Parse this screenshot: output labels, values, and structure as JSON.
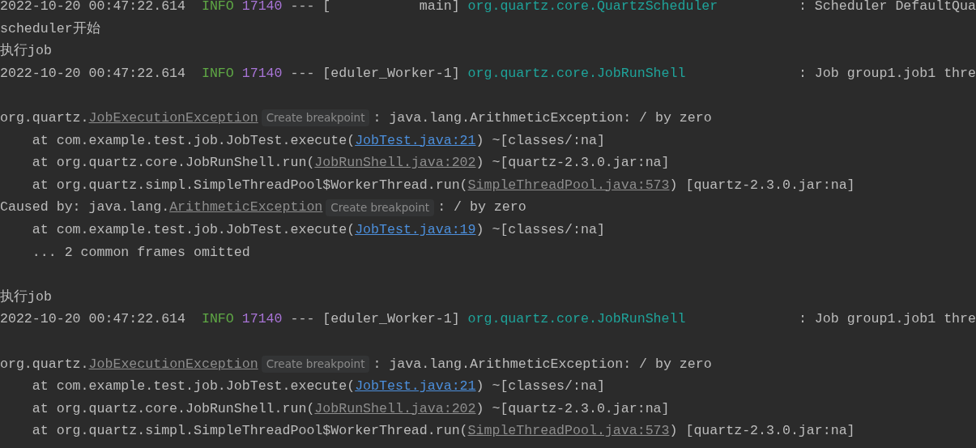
{
  "console": {
    "lines": [
      {
        "kind": "log",
        "timestamp": "2022-10-20 00:47:22.614",
        "level": "INFO",
        "pid": "17140",
        "separator": "---",
        "thread": "[           main]",
        "logger": "org.quartz.core.QuartzScheduler",
        "message": ": Scheduler DefaultQua"
      },
      {
        "kind": "text",
        "parts": [
          {
            "kind": "plain",
            "text": "scheduler开始"
          }
        ]
      },
      {
        "kind": "text",
        "parts": [
          {
            "kind": "plain",
            "text": "执行job"
          }
        ]
      },
      {
        "kind": "log",
        "timestamp": "2022-10-20 00:47:22.614",
        "level": "INFO",
        "pid": "17140",
        "separator": "---",
        "thread": "[eduler_Worker-1]",
        "logger": "org.quartz.core.JobRunShell",
        "message": ": Job group1.job1 thre"
      },
      {
        "kind": "blank"
      },
      {
        "kind": "text",
        "parts": [
          {
            "kind": "plain",
            "text": "org.quartz."
          },
          {
            "kind": "class_link",
            "text": "JobExecutionException"
          },
          {
            "kind": "hint",
            "text": "Create breakpoint"
          },
          {
            "kind": "plain",
            "text": ": java.lang.ArithmeticException: / by zero"
          }
        ]
      },
      {
        "kind": "frame",
        "parts": [
          {
            "kind": "plain",
            "text": "at com.example.test.job.JobTest.execute("
          },
          {
            "kind": "link",
            "text": "JobTest.java:21"
          },
          {
            "kind": "plain",
            "text": ") ~[classes/:na]"
          }
        ]
      },
      {
        "kind": "frame",
        "parts": [
          {
            "kind": "plain",
            "text": "at org.quartz.core.JobRunShell.run("
          },
          {
            "kind": "file_link",
            "text": "JobRunShell.java:202"
          },
          {
            "kind": "plain",
            "text": ") ~[quartz-2.3.0.jar:na]"
          }
        ]
      },
      {
        "kind": "frame",
        "parts": [
          {
            "kind": "plain",
            "text": "at org.quartz.simpl.SimpleThreadPool$WorkerThread.run("
          },
          {
            "kind": "file_link",
            "text": "SimpleThreadPool.java:573"
          },
          {
            "kind": "plain",
            "text": ") [quartz-2.3.0.jar:na]"
          }
        ]
      },
      {
        "kind": "text",
        "parts": [
          {
            "kind": "plain",
            "text": "Caused by: java.lang."
          },
          {
            "kind": "class_link",
            "text": "ArithmeticException"
          },
          {
            "kind": "hint",
            "text": "Create breakpoint"
          },
          {
            "kind": "plain",
            "text": ": / by zero"
          }
        ]
      },
      {
        "kind": "frame",
        "parts": [
          {
            "kind": "plain",
            "text": "at com.example.test.job.JobTest.execute("
          },
          {
            "kind": "link",
            "text": "JobTest.java:19"
          },
          {
            "kind": "plain",
            "text": ") ~[classes/:na]"
          }
        ]
      },
      {
        "kind": "frame",
        "parts": [
          {
            "kind": "plain",
            "text": "... 2 common frames omitted"
          }
        ]
      },
      {
        "kind": "blank"
      },
      {
        "kind": "text",
        "parts": [
          {
            "kind": "plain",
            "text": "执行job"
          }
        ]
      },
      {
        "kind": "log",
        "timestamp": "2022-10-20 00:47:22.614",
        "level": "INFO",
        "pid": "17140",
        "separator": "---",
        "thread": "[eduler_Worker-1]",
        "logger": "org.quartz.core.JobRunShell",
        "message": ": Job group1.job1 thre"
      },
      {
        "kind": "blank"
      },
      {
        "kind": "text",
        "parts": [
          {
            "kind": "plain",
            "text": "org.quartz."
          },
          {
            "kind": "class_link",
            "text": "JobExecutionException"
          },
          {
            "kind": "hint",
            "text": "Create breakpoint"
          },
          {
            "kind": "plain",
            "text": ": java.lang.ArithmeticException: / by zero"
          }
        ]
      },
      {
        "kind": "frame",
        "parts": [
          {
            "kind": "plain",
            "text": "at com.example.test.job.JobTest.execute("
          },
          {
            "kind": "link",
            "text": "JobTest.java:21"
          },
          {
            "kind": "plain",
            "text": ") ~[classes/:na]"
          }
        ]
      },
      {
        "kind": "frame",
        "parts": [
          {
            "kind": "plain",
            "text": "at org.quartz.core.JobRunShell.run("
          },
          {
            "kind": "file_link",
            "text": "JobRunShell.java:202"
          },
          {
            "kind": "plain",
            "text": ") ~[quartz-2.3.0.jar:na]"
          }
        ]
      },
      {
        "kind": "frame",
        "parts": [
          {
            "kind": "plain",
            "text": "at org.quartz.simpl.SimpleThreadPool$WorkerThread.run("
          },
          {
            "kind": "file_link",
            "text": "SimpleThreadPool.java:573"
          },
          {
            "kind": "plain",
            "text": ") [quartz-2.3.0.jar:na]"
          }
        ]
      }
    ]
  }
}
